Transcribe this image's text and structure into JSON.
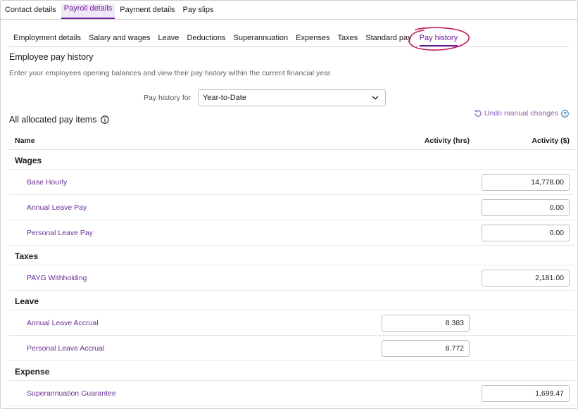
{
  "top_tabs": [
    {
      "label": "Contact details"
    },
    {
      "label": "Payroll details"
    },
    {
      "label": "Payment details"
    },
    {
      "label": "Pay slips"
    }
  ],
  "sub_tabs": [
    {
      "label": "Employment details"
    },
    {
      "label": "Salary and wages"
    },
    {
      "label": "Leave"
    },
    {
      "label": "Deductions"
    },
    {
      "label": "Superannuation"
    },
    {
      "label": "Expenses"
    },
    {
      "label": "Taxes"
    },
    {
      "label": "Standard pay"
    },
    {
      "label": "Pay history"
    }
  ],
  "section": {
    "title": "Employee pay history",
    "description": "Enter your employees opening balances and view their pay history within the current financial year."
  },
  "filter": {
    "label": "Pay history for",
    "value": "Year-to-Date"
  },
  "items_title": "All allocated pay items",
  "undo_label": "Undo manual changes",
  "table": {
    "headers": {
      "name": "Name",
      "hours": "Activity (hrs)",
      "amount": "Activity ($)"
    },
    "groups": [
      {
        "name": "Wages",
        "items": [
          {
            "label": "Base Hourly",
            "amount": "14,778.00"
          },
          {
            "label": "Annual Leave Pay",
            "amount": "0.00"
          },
          {
            "label": "Personal Leave Pay",
            "amount": "0.00"
          }
        ]
      },
      {
        "name": "Taxes",
        "items": [
          {
            "label": "PAYG Withholding",
            "amount": "2,181.00"
          }
        ]
      },
      {
        "name": "Leave",
        "items": [
          {
            "label": "Annual Leave Accrual",
            "hours": "8.383"
          },
          {
            "label": "Personal Leave Accrual",
            "hours": "8.772"
          }
        ]
      },
      {
        "name": "Expense",
        "items": [
          {
            "label": "Superannuation Guarantee",
            "amount": "1,699.47"
          }
        ]
      }
    ]
  },
  "colors": {
    "accent": "#6b1f9a",
    "link": "#6b2f97",
    "annotation": "#c2185b"
  }
}
